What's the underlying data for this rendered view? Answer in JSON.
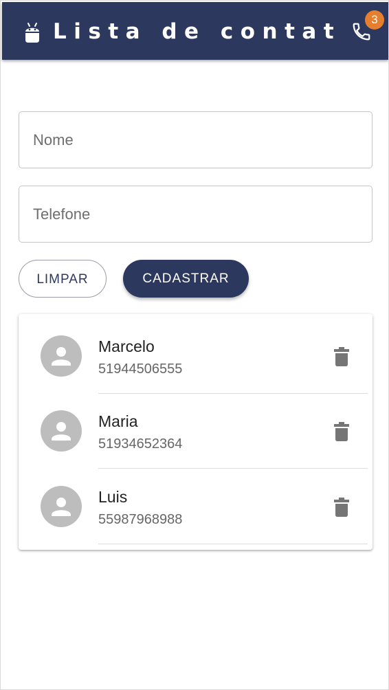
{
  "header": {
    "title": "Lista de contatos",
    "badge_count": "3",
    "icons": {
      "logo": "android-icon",
      "action": "phone-icon"
    }
  },
  "form": {
    "name_placeholder": "Nome",
    "name_value": "",
    "phone_placeholder": "Telefone",
    "phone_value": ""
  },
  "buttons": {
    "clear_label": "LIMPAR",
    "submit_label": "CADASTRAR"
  },
  "contacts": [
    {
      "name": "Marcelo",
      "phone": "51944506555"
    },
    {
      "name": "Maria",
      "phone": "51934652364"
    },
    {
      "name": "Luis",
      "phone": "55987968988"
    }
  ],
  "colors": {
    "primary": "#2c385e",
    "badge": "#e57f2f",
    "avatar": "#bdbdbd",
    "delete_icon": "#757575"
  }
}
